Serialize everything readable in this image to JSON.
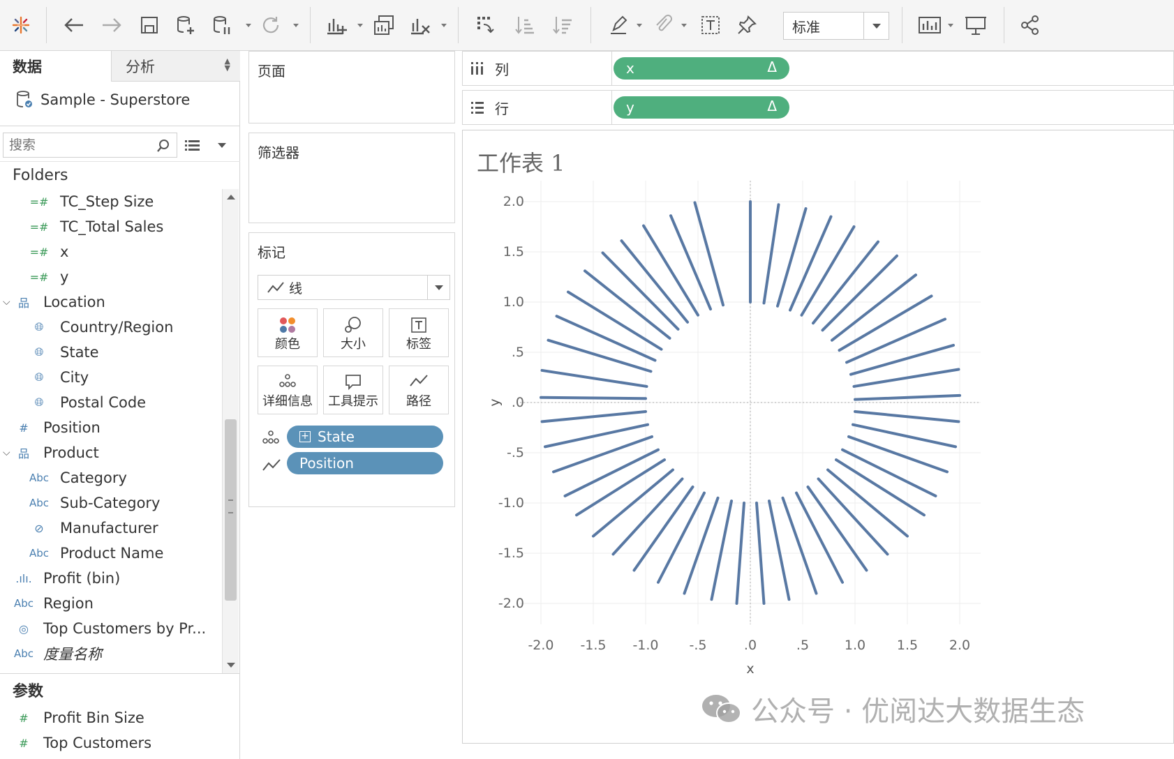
{
  "toolbar": {
    "view_mode": "标准",
    "icons": [
      "tableau-logo-icon",
      "undo-icon",
      "redo-icon",
      "save-icon",
      "new-datasource-icon",
      "pause-updates-icon",
      "refresh-icon",
      "new-worksheet-icon",
      "duplicate-sheet-icon",
      "clear-sheet-icon",
      "swap-rows-columns-icon",
      "sort-ascending-icon",
      "sort-descending-icon",
      "highlight-icon",
      "group-icon",
      "show-labels-icon",
      "pin-axes-icon",
      "show-me-icon",
      "presentation-mode-icon",
      "share-icon"
    ]
  },
  "data_pane": {
    "tabs": [
      "数据",
      "分析"
    ],
    "datasource": "Sample - Superstore",
    "search_placeholder": "搜索",
    "folders_heading": "Folders",
    "fields": [
      {
        "label": "TC_Step Size",
        "type": "measure-calc"
      },
      {
        "label": "TC_Total Sales",
        "type": "measure-calc"
      },
      {
        "label": "x",
        "type": "measure-calc"
      },
      {
        "label": "y",
        "type": "measure-calc"
      },
      {
        "label": "Location",
        "type": "hierarchy"
      },
      {
        "label": "Country/Region",
        "type": "geo"
      },
      {
        "label": "State",
        "type": "geo"
      },
      {
        "label": "City",
        "type": "geo"
      },
      {
        "label": "Postal Code",
        "type": "geo"
      },
      {
        "label": "Position",
        "type": "measure"
      },
      {
        "label": "Product",
        "type": "hierarchy"
      },
      {
        "label": "Category",
        "type": "string"
      },
      {
        "label": "Sub-Category",
        "type": "string"
      },
      {
        "label": "Manufacturer",
        "type": "group"
      },
      {
        "label": "Product Name",
        "type": "string"
      },
      {
        "label": "Profit (bin)",
        "type": "bin"
      },
      {
        "label": "Region",
        "type": "string"
      },
      {
        "label": "Top Customers by Pr...",
        "type": "set"
      },
      {
        "label": "度量名称",
        "type": "string"
      }
    ],
    "params_heading": "参数",
    "params": [
      {
        "label": "Profit Bin Size"
      },
      {
        "label": "Top Customers"
      }
    ]
  },
  "cards": {
    "pages": "页面",
    "filters": "筛选器",
    "marks": "标记",
    "mark_type": "线",
    "mark_buttons": [
      "颜色",
      "大小",
      "标签",
      "详细信息",
      "工具提示",
      "路径"
    ],
    "mark_pills": [
      {
        "label": "State",
        "role": "detail"
      },
      {
        "label": "Position",
        "role": "path"
      }
    ]
  },
  "shelves": {
    "columns_label": "列",
    "rows_label": "行",
    "columns_pill": "x",
    "rows_pill": "y",
    "delta": "Δ"
  },
  "worksheet": {
    "title": "工作表 1"
  },
  "watermark": "公众号 · 优阅达大数据生态",
  "colors": {
    "line": "#5878a3",
    "pill_blue": "#5b92b8",
    "pill_green": "#4faf7e"
  },
  "chart_data": {
    "type": "line",
    "xlabel": "x",
    "ylabel": "y",
    "xlim": [
      -2.0,
      2.0
    ],
    "ylim": [
      -2.0,
      2.0
    ],
    "x_ticks": [
      "-2.0",
      "-1.5",
      "-1.0",
      "-.5",
      ".0",
      ".5",
      "1.0",
      "1.5",
      "2.0"
    ],
    "y_ticks": [
      "2.0",
      "1.5",
      "1.0",
      ".5",
      ".0",
      "-.5",
      "-1.0",
      "-1.5",
      "-2.0"
    ],
    "grid": true,
    "segments": [
      {
        "inner": [
          -1.0,
          0.04
        ],
        "outer": [
          -2.0,
          0.05
        ]
      },
      {
        "inner": [
          -0.99,
          0.16
        ],
        "outer": [
          -1.99,
          0.32
        ]
      },
      {
        "inner": [
          -0.95,
          0.31
        ],
        "outer": [
          -1.93,
          0.62
        ]
      },
      {
        "inner": [
          -0.91,
          0.42
        ],
        "outer": [
          -1.85,
          0.86
        ]
      },
      {
        "inner": [
          -0.85,
          0.53
        ],
        "outer": [
          -1.74,
          1.1
        ]
      },
      {
        "inner": [
          -0.77,
          0.64
        ],
        "outer": [
          -1.58,
          1.31
        ]
      },
      {
        "inner": [
          -0.69,
          0.73
        ],
        "outer": [
          -1.41,
          1.49
        ]
      },
      {
        "inner": [
          -0.6,
          0.8
        ],
        "outer": [
          -1.23,
          1.61
        ]
      },
      {
        "inner": [
          -0.5,
          0.87
        ],
        "outer": [
          -1.02,
          1.76
        ]
      },
      {
        "inner": [
          -0.38,
          0.93
        ],
        "outer": [
          -0.76,
          1.86
        ]
      },
      {
        "inner": [
          -0.26,
          0.97
        ],
        "outer": [
          -0.53,
          1.99
        ]
      },
      {
        "inner": [
          0.0,
          1.0
        ],
        "outer": [
          0.0,
          2.0
        ]
      },
      {
        "inner": [
          0.13,
          0.99
        ],
        "outer": [
          0.27,
          1.97
        ]
      },
      {
        "inner": [
          0.26,
          0.96
        ],
        "outer": [
          0.53,
          1.93
        ]
      },
      {
        "inner": [
          0.38,
          0.92
        ],
        "outer": [
          0.77,
          1.85
        ]
      },
      {
        "inner": [
          0.49,
          0.87
        ],
        "outer": [
          0.99,
          1.75
        ]
      },
      {
        "inner": [
          0.6,
          0.79
        ],
        "outer": [
          1.22,
          1.6
        ]
      },
      {
        "inner": [
          0.69,
          0.72
        ],
        "outer": [
          1.4,
          1.46
        ]
      },
      {
        "inner": [
          0.78,
          0.62
        ],
        "outer": [
          1.58,
          1.27
        ]
      },
      {
        "inner": [
          0.85,
          0.52
        ],
        "outer": [
          1.73,
          1.06
        ]
      },
      {
        "inner": [
          0.92,
          0.4
        ],
        "outer": [
          1.86,
          0.83
        ]
      },
      {
        "inner": [
          0.96,
          0.28
        ],
        "outer": [
          1.94,
          0.57
        ]
      },
      {
        "inner": [
          0.99,
          0.16
        ],
        "outer": [
          1.99,
          0.33
        ]
      },
      {
        "inner": [
          1.0,
          0.03
        ],
        "outer": [
          2.0,
          0.07
        ]
      },
      {
        "inner": [
          1.0,
          -0.09
        ],
        "outer": [
          1.99,
          -0.19
        ]
      },
      {
        "inner": [
          0.98,
          -0.22
        ],
        "outer": [
          1.96,
          -0.44
        ]
      },
      {
        "inner": [
          0.94,
          -0.34
        ],
        "outer": [
          1.88,
          -0.69
        ]
      },
      {
        "inner": [
          0.88,
          -0.47
        ],
        "outer": [
          1.77,
          -0.93
        ]
      },
      {
        "inner": [
          0.82,
          -0.57
        ],
        "outer": [
          1.66,
          -1.12
        ]
      },
      {
        "inner": [
          0.74,
          -0.67
        ],
        "outer": [
          1.5,
          -1.33
        ]
      },
      {
        "inner": [
          0.65,
          -0.76
        ],
        "outer": [
          1.31,
          -1.51
        ]
      },
      {
        "inner": [
          0.55,
          -0.84
        ],
        "outer": [
          1.11,
          -1.67
        ]
      },
      {
        "inner": [
          0.44,
          -0.9
        ],
        "outer": [
          0.88,
          -1.79
        ]
      },
      {
        "inner": [
          0.31,
          -0.95
        ],
        "outer": [
          0.63,
          -1.9
        ]
      },
      {
        "inner": [
          0.18,
          -0.98
        ],
        "outer": [
          0.37,
          -1.96
        ]
      },
      {
        "inner": [
          0.06,
          -1.0
        ],
        "outer": [
          0.13,
          -2.0
        ]
      },
      {
        "inner": [
          -0.06,
          -1.0
        ],
        "outer": [
          -0.13,
          -2.0
        ]
      },
      {
        "inner": [
          -0.18,
          -0.98
        ],
        "outer": [
          -0.37,
          -1.96
        ]
      },
      {
        "inner": [
          -0.31,
          -0.95
        ],
        "outer": [
          -0.63,
          -1.9
        ]
      },
      {
        "inner": [
          -0.44,
          -0.9
        ],
        "outer": [
          -0.88,
          -1.79
        ]
      },
      {
        "inner": [
          -0.55,
          -0.84
        ],
        "outer": [
          -1.11,
          -1.67
        ]
      },
      {
        "inner": [
          -0.65,
          -0.76
        ],
        "outer": [
          -1.31,
          -1.51
        ]
      },
      {
        "inner": [
          -0.74,
          -0.67
        ],
        "outer": [
          -1.5,
          -1.33
        ]
      },
      {
        "inner": [
          -0.82,
          -0.57
        ],
        "outer": [
          -1.66,
          -1.12
        ]
      },
      {
        "inner": [
          -0.88,
          -0.47
        ],
        "outer": [
          -1.77,
          -0.93
        ]
      },
      {
        "inner": [
          -0.94,
          -0.34
        ],
        "outer": [
          -1.88,
          -0.69
        ]
      },
      {
        "inner": [
          -0.98,
          -0.22
        ],
        "outer": [
          -1.96,
          -0.44
        ]
      },
      {
        "inner": [
          -1.0,
          -0.09
        ],
        "outer": [
          -1.99,
          -0.19
        ]
      }
    ]
  }
}
